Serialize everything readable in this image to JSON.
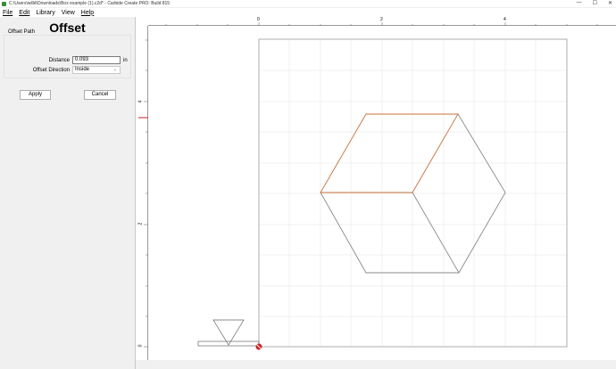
{
  "window": {
    "title": "C:\\Users\\willd\\Downloads\\Box example (1).c2d* - Carbide Create PRO: Build 815",
    "controls": [
      "—",
      "☐",
      "✕"
    ]
  },
  "menu": {
    "file": "File",
    "edit": "Edit",
    "library": "Library",
    "view": "View",
    "help": "Help"
  },
  "panel": {
    "heading": "Offset",
    "group_label": "Offset Path",
    "distance_label": "Distance",
    "distance_value": "0.093",
    "distance_unit": "in",
    "direction_label": "Offset Direction",
    "direction_value": "Inside",
    "apply_label": "Apply",
    "cancel_label": "Cancel"
  },
  "rulers": {
    "horizontal": [
      "0",
      "2",
      "4"
    ],
    "vertical": [
      "4",
      "2",
      "0"
    ]
  },
  "colors": {
    "selected_path": "#c8703a",
    "path": "#8a8a8a",
    "grid": "#e6e6e6",
    "origin_marker": "#cc2222"
  }
}
